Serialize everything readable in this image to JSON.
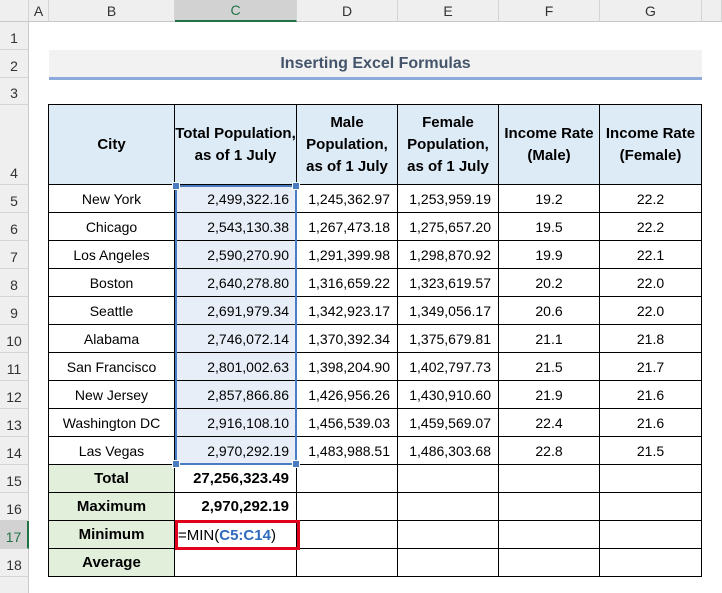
{
  "columns": [
    "A",
    "B",
    "C",
    "D",
    "E",
    "F",
    "G"
  ],
  "rows": [
    "1",
    "2",
    "3",
    "4",
    "5",
    "6",
    "7",
    "8",
    "9",
    "10",
    "11",
    "12",
    "13",
    "14",
    "15",
    "16",
    "17",
    "18"
  ],
  "title": "Inserting Excel Formulas",
  "headers": [
    "City",
    "Total Population, as of 1 July",
    "Male Population, as of 1 July",
    "Female Population, as of 1 July",
    "Income Rate (Male)",
    "Income Rate (Female)"
  ],
  "table": [
    [
      "New York",
      "2,499,322.16",
      "1,245,362.97",
      "1,253,959.19",
      "19.2",
      "22.2"
    ],
    [
      "Chicago",
      "2,543,130.38",
      "1,267,473.18",
      "1,275,657.20",
      "19.5",
      "22.2"
    ],
    [
      "Los Angeles",
      "2,590,270.90",
      "1,291,399.98",
      "1,298,870.92",
      "19.9",
      "22.1"
    ],
    [
      "Boston",
      "2,640,278.80",
      "1,316,659.22",
      "1,323,619.57",
      "20.2",
      "22.0"
    ],
    [
      "Seattle",
      "2,691,979.34",
      "1,342,923.17",
      "1,349,056.17",
      "20.6",
      "22.0"
    ],
    [
      "Alabama",
      "2,746,072.14",
      "1,370,392.34",
      "1,375,679.81",
      "21.1",
      "21.8"
    ],
    [
      "San Francisco",
      "2,801,002.63",
      "1,398,204.90",
      "1,402,797.73",
      "21.5",
      "21.7"
    ],
    [
      "New Jersey",
      "2,857,866.86",
      "1,426,956.26",
      "1,430,910.60",
      "21.9",
      "21.6"
    ],
    [
      "Washington DC",
      "2,916,108.10",
      "1,456,539.03",
      "1,459,569.07",
      "22.4",
      "21.6"
    ],
    [
      "Las Vegas",
      "2,970,292.19",
      "1,483,988.51",
      "1,486,303.68",
      "22.8",
      "21.5"
    ]
  ],
  "summary": [
    {
      "label": "Total",
      "value": "27,256,323.49"
    },
    {
      "label": "Maximum",
      "value": "2,970,292.19"
    },
    {
      "label": "Minimum",
      "value": ""
    },
    {
      "label": "Average",
      "value": ""
    }
  ],
  "formula": {
    "prefix": "=MIN(",
    "ref": "C5:C14",
    "suffix": ")"
  },
  "colors": {
    "header_fill": "#ddebf7",
    "summary_fill": "#e2efda",
    "highlight": "#e0001b",
    "range": "#4a7cc2"
  }
}
